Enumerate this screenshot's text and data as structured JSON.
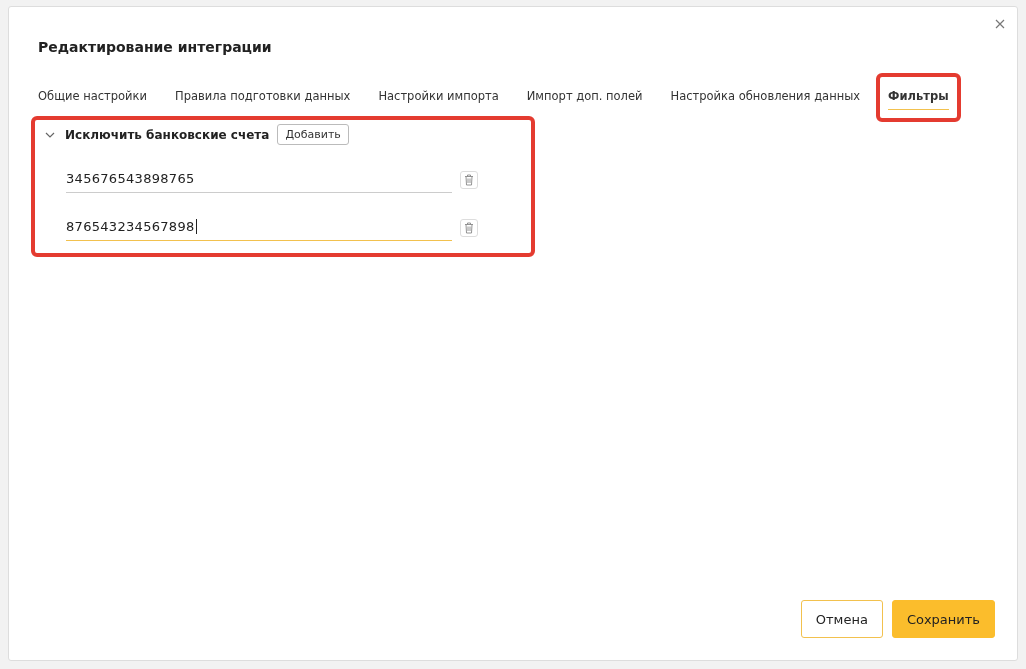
{
  "dialog": {
    "title": "Редактирование интеграции"
  },
  "tabs": [
    {
      "label": "Общие настройки",
      "selected": false,
      "highlighted": false
    },
    {
      "label": "Правила подготовки данных",
      "selected": false,
      "highlighted": false
    },
    {
      "label": "Настройки импорта",
      "selected": false,
      "highlighted": false
    },
    {
      "label": "Импорт доп. полей",
      "selected": false,
      "highlighted": false
    },
    {
      "label": "Настройка обновления данных",
      "selected": false,
      "highlighted": false
    },
    {
      "label": "Фильтры",
      "selected": true,
      "highlighted": true
    }
  ],
  "section": {
    "title": "Исключить банковские счета",
    "expanded": true,
    "highlighted": true,
    "add_button": "Добавить",
    "fields": [
      {
        "value": "345676543898765",
        "focused": false
      },
      {
        "value": "876543234567898",
        "focused": true
      }
    ]
  },
  "buttons": [
    {
      "label": "Отмена",
      "kind": "secondary"
    },
    {
      "label": "Сохранить",
      "kind": "primary"
    }
  ]
}
